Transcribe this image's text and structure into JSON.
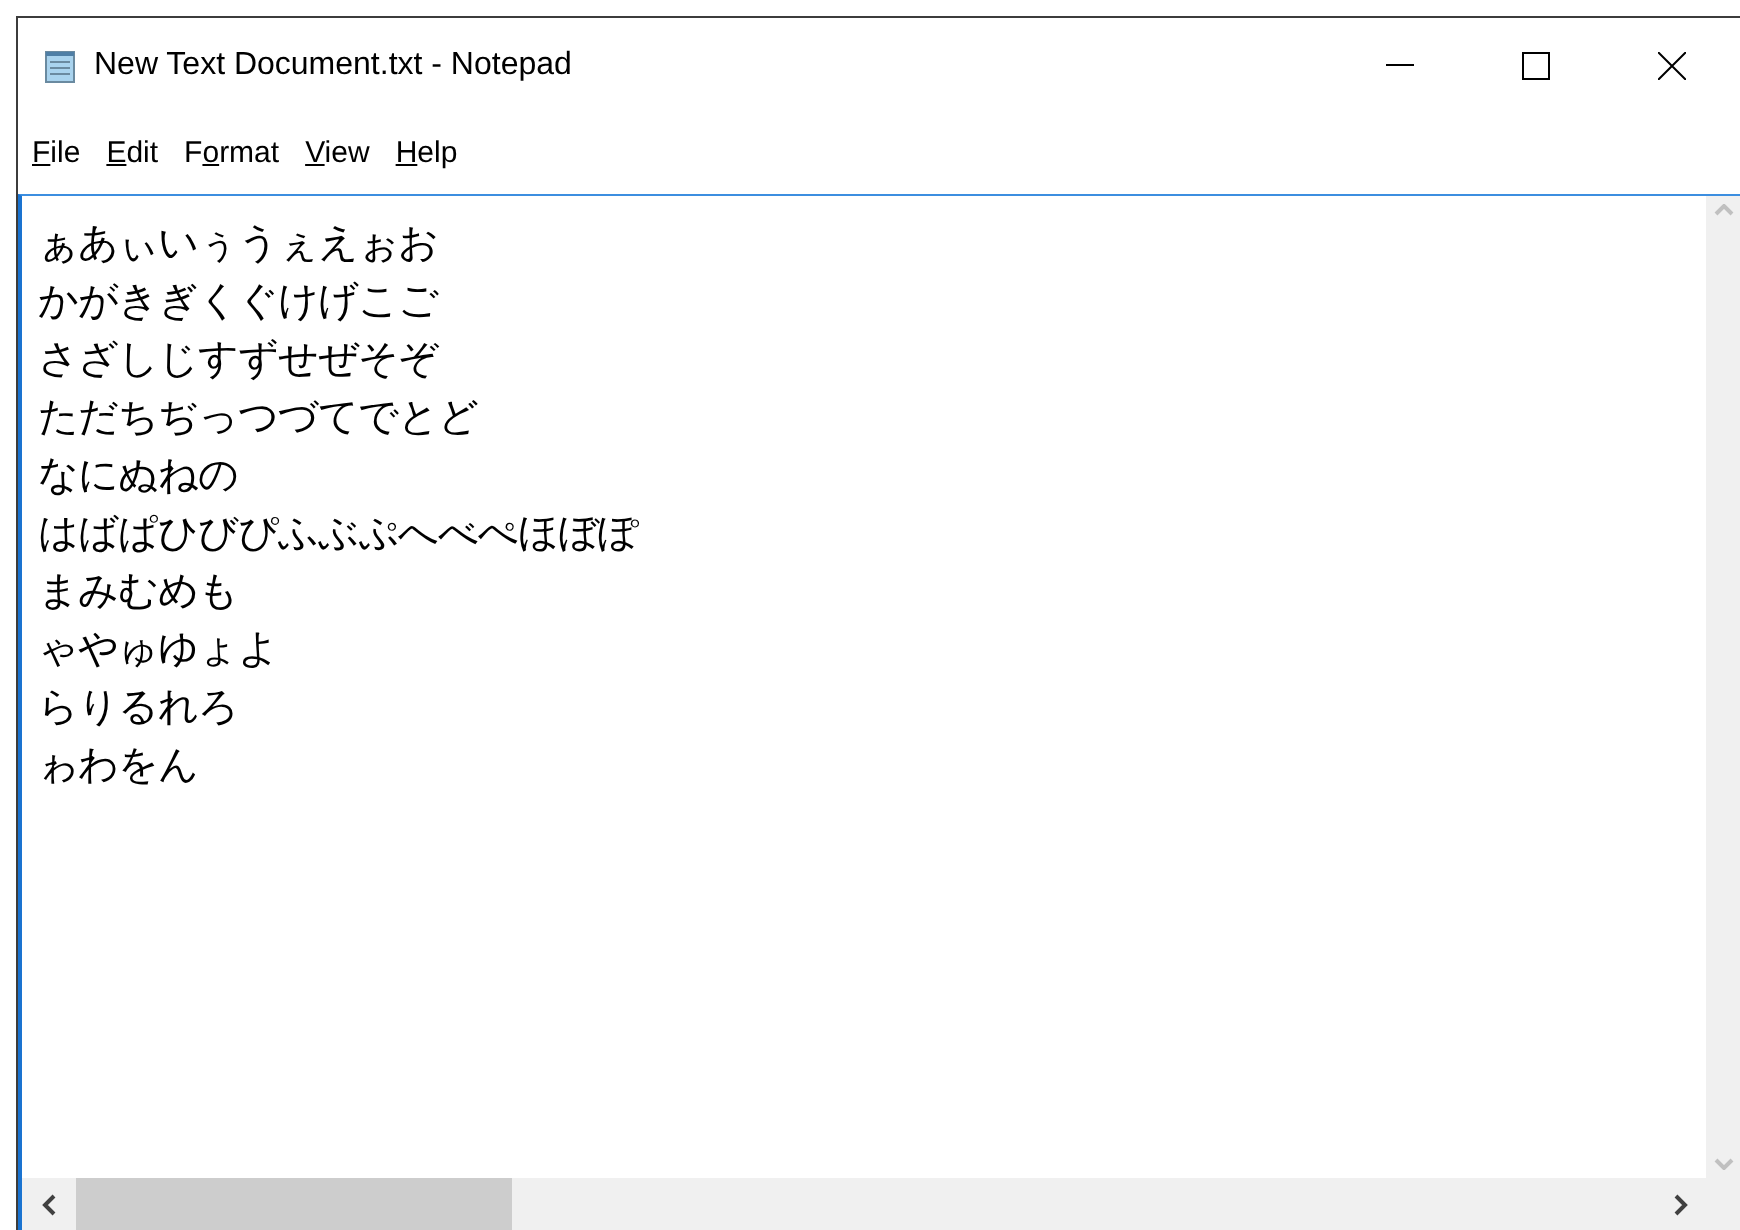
{
  "window": {
    "title": "New Text Document.txt - Notepad"
  },
  "menu": [
    {
      "parts": [
        {
          "text": "F",
          "underlined": true
        },
        {
          "text": "ile",
          "underlined": false
        }
      ]
    },
    {
      "parts": [
        {
          "text": "E",
          "underlined": true
        },
        {
          "text": "dit",
          "underlined": false
        }
      ]
    },
    {
      "parts": [
        {
          "text": "F",
          "underlined": false
        },
        {
          "text": "o",
          "underlined": true
        },
        {
          "text": "rmat",
          "underlined": false
        }
      ]
    },
    {
      "parts": [
        {
          "text": "V",
          "underlined": true
        },
        {
          "text": "iew",
          "underlined": false
        }
      ]
    },
    {
      "parts": [
        {
          "text": "H",
          "underlined": true
        },
        {
          "text": "elp",
          "underlined": false
        }
      ]
    }
  ],
  "editor": {
    "lines": [
      "ぁあぃいぅうぇえぉお",
      "かがきぎくぐけげこご",
      "さざしじすずせぜそぞ",
      "ただちぢっつづてでとど",
      "なにぬねの",
      "はばぱひびぴふぶぷへべぺほぼぽ",
      "まみむめも",
      "ゃやゅゆょよ",
      "らりるれろ",
      "ゎわをん"
    ]
  }
}
